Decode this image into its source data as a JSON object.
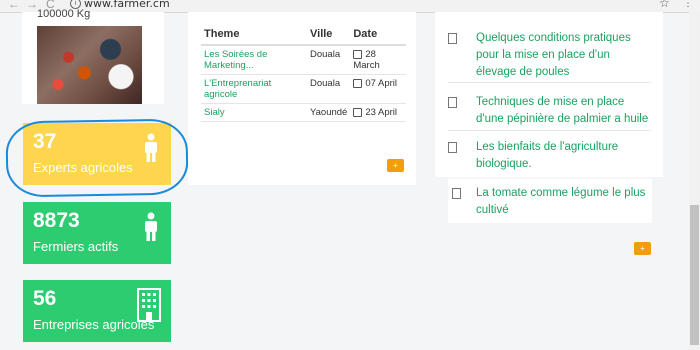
{
  "browser": {
    "url": "www.farmer.cm",
    "back": "←",
    "forward": "→",
    "reload": "C",
    "star": "☆",
    "menu": "⋮"
  },
  "photo_card": {
    "caption": "100000 Kg"
  },
  "stats": [
    {
      "value": "37",
      "label": "Experts agricoles",
      "icon": "person-icon"
    },
    {
      "value": "8873",
      "label": "Fermiers actifs",
      "icon": "person-icon"
    },
    {
      "value": "56",
      "label": "Entreprises agricoles",
      "icon": "building-icon"
    }
  ],
  "events": {
    "headers": {
      "theme": "Theme",
      "ville": "Ville",
      "date": "Date"
    },
    "rows": [
      {
        "theme": "Les Soirées de Marketing...",
        "ville": "Douala",
        "date": "28 March"
      },
      {
        "theme": "L'Entreprenariat agricole",
        "ville": "Douala",
        "date": "07 April"
      },
      {
        "theme": "Sialy",
        "ville": "Yaoundé",
        "date": "23 April"
      }
    ],
    "more": "+"
  },
  "articles": {
    "items": [
      "Quelques conditions pratiques pour la mise en place d'un élevage de poules",
      "Techniques de mise en place d'une pépinière de palmier a huile",
      "Les bienfaits de l'agriculture biologique.",
      "La tomate comme légume le plus cultivé"
    ],
    "more": "+"
  },
  "colors": {
    "yellow": "#fdd54f",
    "green": "#2ecc71",
    "link": "#1aa260",
    "orange": "#f39c12"
  }
}
